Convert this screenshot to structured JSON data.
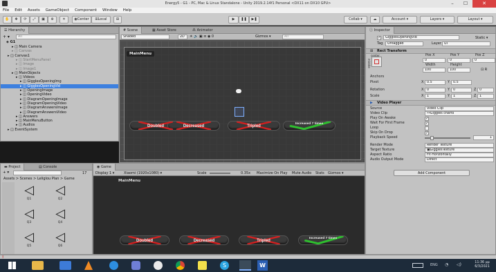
{
  "window": {
    "title": "Energy5 - G1 - PC, Mac & Linux Standalone - Unity 2019.2.14f1 Personal <DX11 on DX10 GPU>",
    "controls": [
      "–",
      "☐",
      "✕"
    ]
  },
  "menu": [
    "File",
    "Edit",
    "Assets",
    "GameObject",
    "Component",
    "Window",
    "Help"
  ],
  "toolbar": {
    "pivot_mode": "Center",
    "pivot_rotation": "Local",
    "play": "▶",
    "pause": "❚❚",
    "step": "▶❚",
    "collab": "Collab ▾",
    "account": "Account ▾",
    "layers": "Layers ▾",
    "layout": "Layout ▾"
  },
  "hierarchy": {
    "tab": "Hierarchy",
    "create": "+ ▾",
    "search_placeholder": "All",
    "scene": "G1",
    "items": [
      {
        "label": "Main Camera",
        "indent": 2,
        "state": "normal"
      },
      {
        "label": "Canvas",
        "indent": 2,
        "state": "dim"
      },
      {
        "label": "Canvas1",
        "indent": 1,
        "state": "normal"
      },
      {
        "label": "StartMenuPanel",
        "indent": 3,
        "state": "dim"
      },
      {
        "label": "Image",
        "indent": 3,
        "state": "dim"
      },
      {
        "label": "Image1",
        "indent": 3,
        "state": "dim"
      },
      {
        "label": "MainObjects",
        "indent": 2,
        "state": "normal"
      },
      {
        "label": "Videos",
        "indent": 3,
        "state": "normal"
      },
      {
        "label": "GigglesOpeningImg",
        "indent": 4,
        "state": "normal"
      },
      {
        "label": "GigglesOpeningVid",
        "indent": 4,
        "state": "selected"
      },
      {
        "label": "OpeningImage",
        "indent": 4,
        "state": "normal"
      },
      {
        "label": "OpeningVideo",
        "indent": 4,
        "state": "normal"
      },
      {
        "label": "DiagramOpeningImage",
        "indent": 4,
        "state": "normal"
      },
      {
        "label": "DiagramOpeningVideo",
        "indent": 4,
        "state": "normal"
      },
      {
        "label": "DiagramAnswersImage",
        "indent": 4,
        "state": "normal"
      },
      {
        "label": "DiagramAnswersVideo",
        "indent": 4,
        "state": "normal"
      },
      {
        "label": "Answers",
        "indent": 3,
        "state": "normal"
      },
      {
        "label": "MainMenuButton",
        "indent": 3,
        "state": "normal"
      },
      {
        "label": "Audios",
        "indent": 3,
        "state": "normal"
      },
      {
        "label": "EventSystem",
        "indent": 1,
        "state": "normal"
      }
    ]
  },
  "scene_view": {
    "tabs": [
      "Scene",
      "Asset Store",
      "Animator"
    ],
    "shading": "Shaded",
    "mode_2d": "2D",
    "gizmos": "Gizmos ▾",
    "search": "All",
    "title_badge": "MainMenu"
  },
  "game_buttons": [
    {
      "label": "Doubled",
      "crossed": true,
      "color": "#d22020"
    },
    {
      "label": "Decreased",
      "crossed": true,
      "color": "#d22020"
    },
    {
      "label": "Tripled",
      "crossed": true,
      "color": "#d22020"
    },
    {
      "label": "Increased 7 times",
      "crossed": false,
      "color": "#2fbf2f"
    }
  ],
  "project": {
    "tabs": [
      "Project",
      "Console"
    ],
    "create": "+ ▾",
    "breadcrumb": "Assets > Scenes > Leliglou Plan > Game",
    "item_count": "17",
    "assets": [
      "Q1",
      "Q2",
      "Q3",
      "Q4",
      "Q5",
      "Q6"
    ]
  },
  "game_view": {
    "tab": "Game",
    "display": "Display 1 ▾",
    "resolution": "Xiaomi (1920x1080) ▾",
    "scale_label": "Scale",
    "scale_value": "0.35x",
    "options": [
      "Maximize On Play",
      "Mute Audio",
      "Stats",
      "Gizmos ▾"
    ],
    "title_badge": "MainMenu"
  },
  "inspector": {
    "tab": "Inspector",
    "object_name": "GigglesOpeningVid",
    "static": "Static ▾",
    "tag_label": "Tag",
    "tag": "Untagged",
    "layer_label": "Layer",
    "layer": "UI",
    "rect_transform": {
      "title": "Rect Transform",
      "anchor": "center",
      "side_label": "middle",
      "pos_x_label": "Pos X",
      "pos_y_label": "Pos Y",
      "pos_z_label": "Pos Z",
      "pos_x": "0",
      "pos_y": "0",
      "pos_z": "0",
      "width_label": "Width",
      "height_label": "Height",
      "width": "100",
      "height": "100",
      "blueprint": "R",
      "anchors": "Anchors",
      "pivot_label": "Pivot",
      "pivot_x": "0.5",
      "pivot_y": "0.5",
      "rotation_label": "Rotation",
      "rot_x": "0",
      "rot_y": "0",
      "rot_z": "0",
      "scale_label": "Scale",
      "scale_x": "1",
      "scale_y": "1",
      "scale_z": "1"
    },
    "video_player": {
      "title": "Video Player",
      "source_label": "Source",
      "source": "Video Clip",
      "clip_label": "Video Clip",
      "clip": "Giggles charts",
      "play_on_awake_label": "Play On Awake",
      "wait_label": "Wait For First Frame",
      "loop_label": "Loop",
      "skip_label": "Skip On Drop",
      "speed_label": "Playback Speed",
      "speed": "1",
      "render_mode_label": "Render Mode",
      "render_mode": "Render Texture",
      "target_label": "Target Texture",
      "target": "GigglesTexture",
      "aspect_label": "Aspect Ratio",
      "aspect": "Fit Horizontally",
      "audio_label": "Audio Output Mode",
      "audio": "Direct"
    },
    "add_component": "Add Component"
  },
  "statusbar": {
    "icon": "!"
  },
  "taskbar": {
    "time": "11:36 μμ",
    "date": "6/3/2021",
    "lang": "ENG"
  },
  "colors": {
    "accent": "#3d80df",
    "wrong": "#d22020",
    "right": "#2fbf2f",
    "editor_bg": "#c2c2c2",
    "game_bg": "#2b2b2b"
  }
}
